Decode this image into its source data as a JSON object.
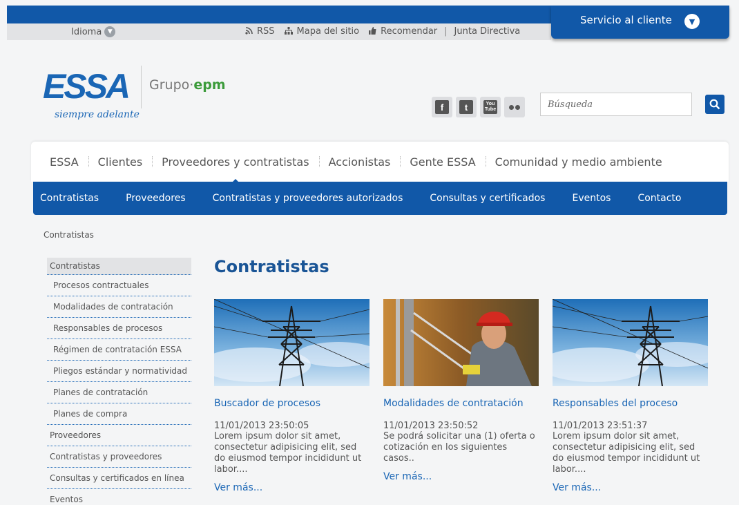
{
  "util": {
    "idioma": "Idioma",
    "links": [
      "RSS",
      "Mapa del sitio",
      "Recomendar",
      "Junta Directiva"
    ]
  },
  "servicio": "Servicio al cliente",
  "logo": {
    "brand": "ESSA",
    "tagline": "siempre adelante",
    "grupo": "Grupo·",
    "epm": "epm"
  },
  "search": {
    "placeholder": "Búsqueda"
  },
  "mainnav": [
    "ESSA",
    "Clientes",
    "Proveedores y contratistas",
    "Accionistas",
    "Gente ESSA",
    "Comunidad y medio ambiente"
  ],
  "subnav": [
    "Contratistas",
    "Proveedores",
    "Contratistas y proveedores autorizados",
    "Consultas y certificados",
    "Eventos",
    "Contacto"
  ],
  "breadcrumb": "Contratistas",
  "sidebar": [
    {
      "label": "Contratistas",
      "level": 0
    },
    {
      "label": "Procesos contractuales",
      "level": 1
    },
    {
      "label": "Modalidades de contratación",
      "level": 1
    },
    {
      "label": "Responsables de procesos",
      "level": 1
    },
    {
      "label": "Régimen de contratación ESSA",
      "level": 1
    },
    {
      "label": "Pliegos estándar y normatividad",
      "level": 1
    },
    {
      "label": "Planes de contratación",
      "level": 1
    },
    {
      "label": "Planes de compra",
      "level": 1
    },
    {
      "label": "Proveedores",
      "level": 0
    },
    {
      "label": "Contratistas y proveedores",
      "level": 0
    },
    {
      "label": "Consultas y certificados en línea",
      "level": 0
    },
    {
      "label": "Eventos",
      "level": 0
    }
  ],
  "page_title": "Contratistas",
  "cards": [
    {
      "title": "Buscador de procesos",
      "date": "11/01/2013 23:50:05",
      "text": "Lorem ipsum dolor sit amet, consectetur adipisicing elit, sed do eiusmod tempor incididunt ut labor....",
      "more": "Ver más..."
    },
    {
      "title": "Modalidades de contratación",
      "date": "11/01/2013 23:50:52",
      "text": "Se podrá solicitar una (1) oferta o cotización en los siguientes casos..",
      "more": "Ver más..."
    },
    {
      "title": "Responsables del proceso",
      "date": "11/01/2013 23:51:37",
      "text": "Lorem ipsum dolor sit amet, consectetur adipisicing elit, sed do eiusmod tempor incididunt ut labor....",
      "more": "Ver más..."
    }
  ],
  "colors": {
    "brand_blue": "#1158a8",
    "epm_green": "#3b9b3a"
  }
}
